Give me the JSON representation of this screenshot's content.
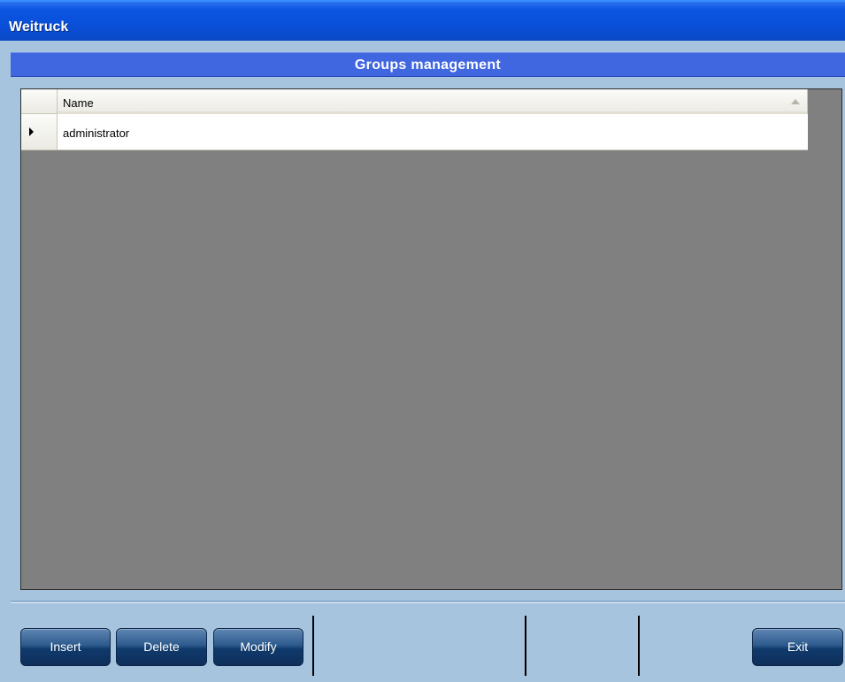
{
  "window": {
    "title": "Weitruck"
  },
  "header": {
    "title": "Groups management"
  },
  "grid": {
    "columns": [
      {
        "label": "Name",
        "sort": "ascending"
      }
    ],
    "rows": [
      {
        "name": "administrator",
        "current": true
      }
    ]
  },
  "toolbar": {
    "insert_label": "Insert",
    "delete_label": "Delete",
    "modify_label": "Modify",
    "exit_label": "Exit"
  },
  "colors": {
    "titlebar": "#0a4fd8",
    "header_band": "#4066e0",
    "panel_background": "#a7c4df",
    "grid_background": "#808080",
    "button": "#1e4b7e"
  },
  "icons": {
    "sort": "sort-ascending-icon",
    "row_indicator": "current-row-arrow-icon"
  }
}
